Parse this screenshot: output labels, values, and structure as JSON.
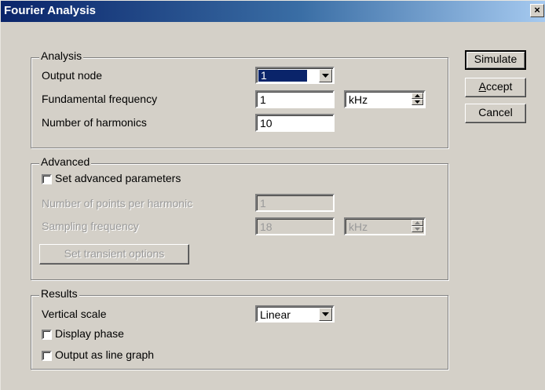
{
  "window": {
    "title": "Fourier Analysis",
    "close_glyph": "×"
  },
  "analysis": {
    "legend": "Analysis",
    "output_node_label": "Output node",
    "output_node_value": "1",
    "fundamental_label": "Fundamental frequency",
    "fundamental_value": "1",
    "fundamental_unit": "kHz",
    "harmonics_label": "Number of harmonics",
    "harmonics_value": "10"
  },
  "advanced": {
    "legend": "Advanced",
    "set_params_label": "Set advanced parameters",
    "points_label": "Number of points per harmonic",
    "points_value": "1",
    "sampling_label": "Sampling frequency",
    "sampling_value": "18",
    "sampling_unit": "kHz",
    "transient_button": "Set transient options"
  },
  "results": {
    "legend": "Results",
    "vscale_label": "Vertical scale",
    "vscale_value": "Linear",
    "display_phase_label": "Display phase",
    "line_graph_label": "Output as line graph"
  },
  "buttons": {
    "simulate": "Simulate",
    "accept_mnemonic": "A",
    "accept_rest": "ccept",
    "cancel": "Cancel"
  }
}
